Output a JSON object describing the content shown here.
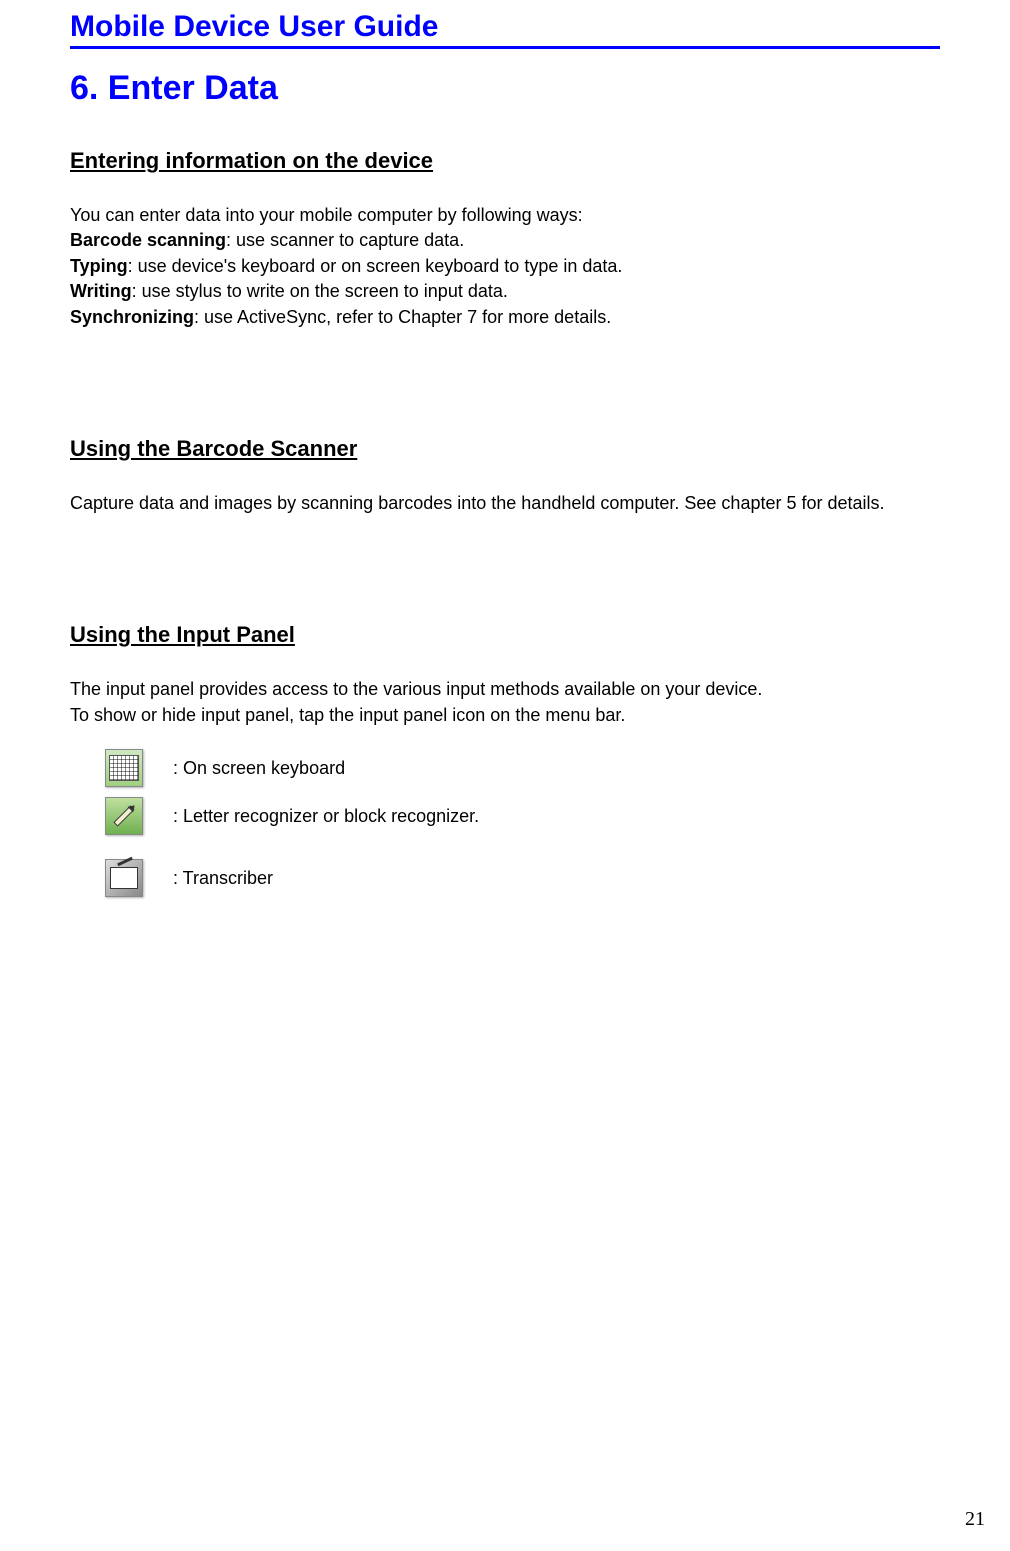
{
  "doc_title": "Mobile Device User Guide",
  "chapter": "6.  Enter Data",
  "section1": {
    "heading": "Entering information on the device",
    "intro": "You can enter data into your mobile computer by following ways:",
    "items": [
      {
        "label": "Barcode scanning",
        "text": ": use scanner to capture data."
      },
      {
        "label": "Typing",
        "text": ": use device's keyboard or on screen keyboard to type in data."
      },
      {
        "label": "Writing",
        "text": ": use stylus to write on the screen to input data."
      },
      {
        "label": "Synchronizing",
        "text": ": use ActiveSync, refer to Chapter 7 for more details."
      }
    ]
  },
  "section2": {
    "heading": "Using the Barcode Scanner",
    "text": "Capture data and images by scanning barcodes into the handheld computer. See chapter 5 for details."
  },
  "section3": {
    "heading": "Using the Input Panel",
    "line1": "The input panel provides access to the various input methods available on your device.",
    "line2": "To show or hide input panel, tap the input panel icon on the menu bar.",
    "icons": [
      {
        "label": ": On screen keyboard"
      },
      {
        "label": ": Letter recognizer or block recognizer."
      },
      {
        "label": ": Transcriber"
      }
    ]
  },
  "page_number": "21"
}
